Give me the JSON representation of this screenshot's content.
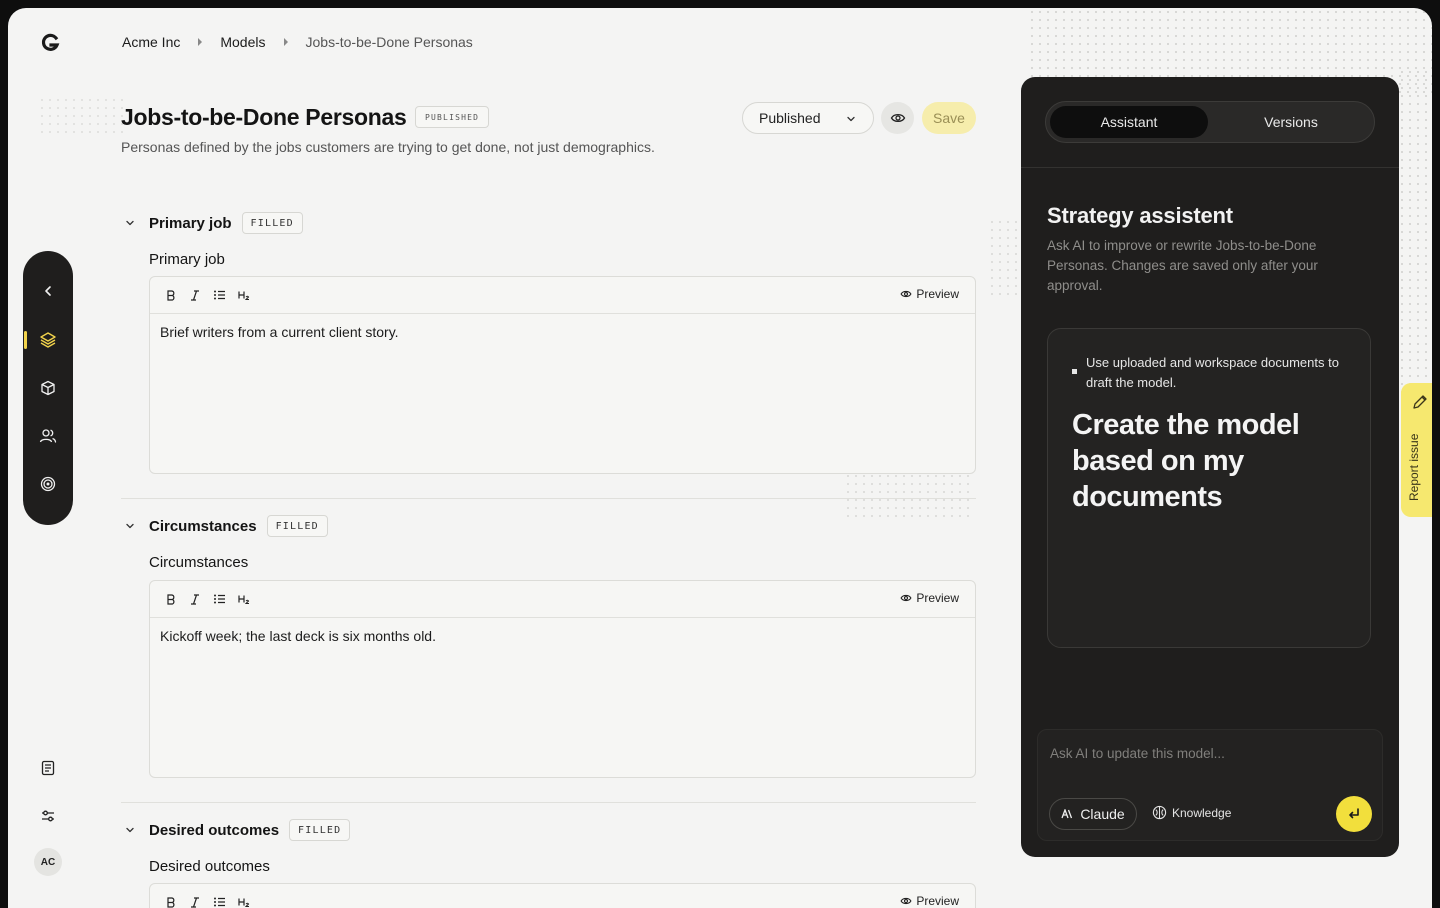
{
  "breadcrumb": {
    "items": [
      "Acme Inc",
      "Models",
      "Jobs-to-be-Done Personas"
    ]
  },
  "header": {
    "title": "Jobs-to-be-Done Personas",
    "status_badge": "PUBLISHED",
    "subtitle": "Personas defined by the jobs customers are trying to get done, not just demographics.",
    "status_select": "Published",
    "save_label": "Save"
  },
  "sections": [
    {
      "label": "Primary job",
      "badge": "FILLED",
      "field_label": "Primary job",
      "preview_label": "Preview",
      "content": "Brief writers from a current client story."
    },
    {
      "label": "Circumstances",
      "badge": "FILLED",
      "field_label": "Circumstances",
      "preview_label": "Preview",
      "content": "Kickoff week; the last deck is six months old."
    },
    {
      "label": "Desired outcomes",
      "badge": "FILLED",
      "field_label": "Desired outcomes",
      "preview_label": "Preview",
      "content": ""
    }
  ],
  "sidebar": {
    "icons": [
      "chevron-left-icon",
      "layers-icon",
      "cube-icon",
      "users-icon",
      "target-icon"
    ],
    "active_index": 1,
    "bottom_icons": [
      "document-icon",
      "settings-sliders-icon"
    ],
    "avatar_initials": "AC"
  },
  "assistant": {
    "tabs": [
      "Assistant",
      "Versions"
    ],
    "active_tab": "Assistant",
    "title": "Strategy assistent",
    "description": "Ask AI to improve or rewrite Jobs-to-be-Done Personas. Changes are saved only after your approval.",
    "suggestion_hint": "Use uploaded and workspace documents to draft the model.",
    "suggestion_big": "Create the model based on my documents",
    "input_placeholder": "Ask AI to update this model...",
    "model_label": "Claude",
    "knowledge_label": "Knowledge"
  },
  "report_issue": {
    "label": "Report issue"
  },
  "colors": {
    "accent_yellow": "#f2df3c",
    "save_bg": "#f6edac",
    "dark_panel": "#1f1e1d",
    "page_bg": "#f4f4f3"
  }
}
